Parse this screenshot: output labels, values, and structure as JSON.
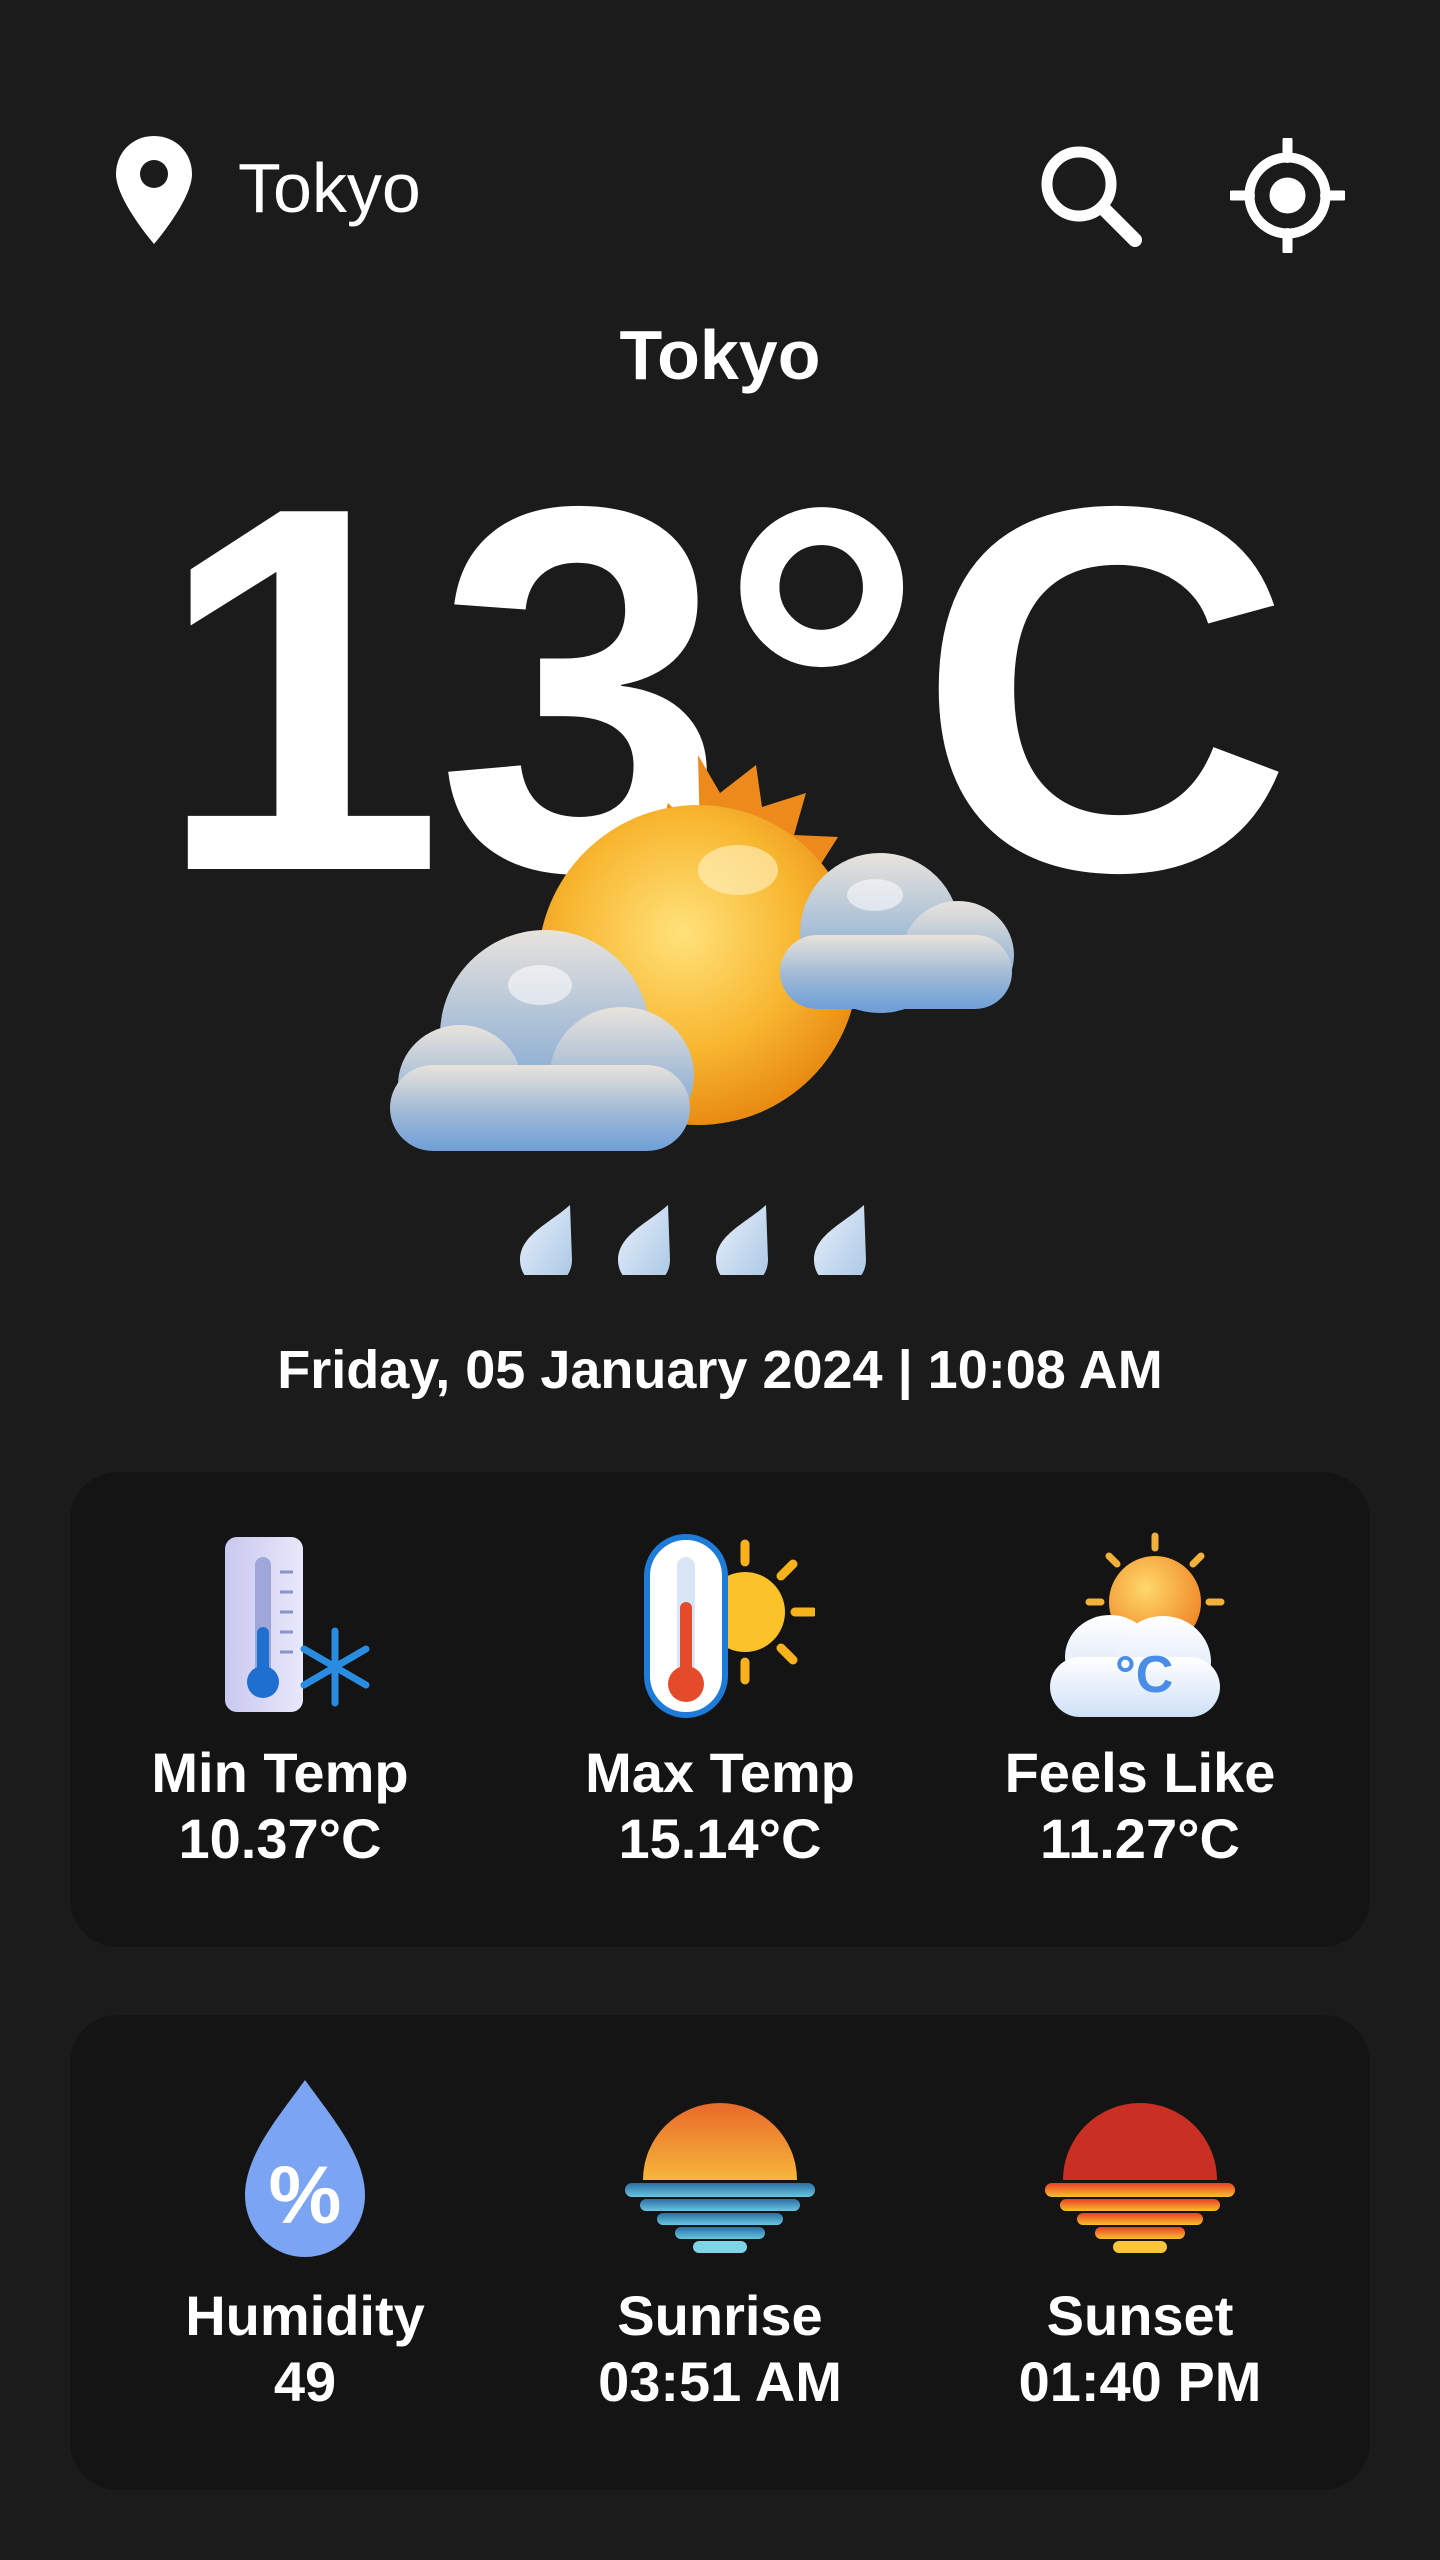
{
  "header": {
    "location_label": "Tokyo",
    "icons": {
      "location": "location-pin-icon",
      "search": "search-icon",
      "gps": "gps-locate-icon"
    }
  },
  "current": {
    "city": "Tokyo",
    "temperature": "13°C",
    "condition_icon": "sun-cloud-rain-icon",
    "datetime": "Friday, 05 January 2024 | 10:08 AM"
  },
  "stats_top": [
    {
      "label": "Min Temp",
      "value": "10.37°C",
      "icon": "thermometer-cold-icon"
    },
    {
      "label": "Max Temp",
      "value": "15.14°C",
      "icon": "thermometer-hot-icon"
    },
    {
      "label": "Feels Like",
      "value": "11.27°C",
      "icon": "feels-like-icon"
    }
  ],
  "stats_bottom": [
    {
      "label": "Humidity",
      "value": "49",
      "icon": "humidity-drop-icon"
    },
    {
      "label": "Sunrise",
      "value": "03:51 AM",
      "icon": "sunrise-icon"
    },
    {
      "label": "Sunset",
      "value": "01:40 PM",
      "icon": "sunset-icon"
    }
  ],
  "colors": {
    "background": "#1b1b1b",
    "card": "#141414",
    "text": "#ffffff"
  }
}
